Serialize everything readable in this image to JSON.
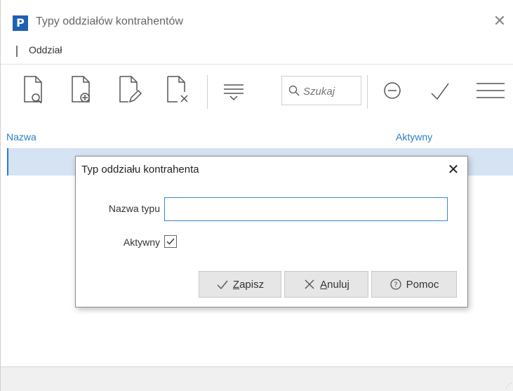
{
  "window": {
    "logo_letter": "P",
    "title": "Typy oddziałów kontrahentów",
    "close_glyph": "✕"
  },
  "menu": {
    "items": [
      "Oddział"
    ]
  },
  "toolbar": {
    "search_placeholder": "Szukaj",
    "icons": [
      "view-document-icon",
      "add-document-icon",
      "edit-document-icon",
      "delete-document-icon",
      "filter-icon",
      "search-icon",
      "deactivate-icon",
      "accept-icon",
      "menu-icon"
    ]
  },
  "grid": {
    "columns": [
      "Nazwa",
      "Aktywny"
    ]
  },
  "dialog": {
    "title": "Typ oddziału kontrahenta",
    "close_glyph": "✕",
    "name_label": "Nazwa typu",
    "name_value": "",
    "active_label": "Aktywny",
    "active_checked": true,
    "buttons": {
      "save_accel": "Z",
      "save_rest": "apisz",
      "cancel_accel": "A",
      "cancel_rest": "nuluj",
      "help_label": "Pomoc"
    }
  },
  "colors": {
    "accent": "#2a7fc3",
    "selected_row": "#d5e3f3",
    "logo": "#1f5fb4"
  }
}
